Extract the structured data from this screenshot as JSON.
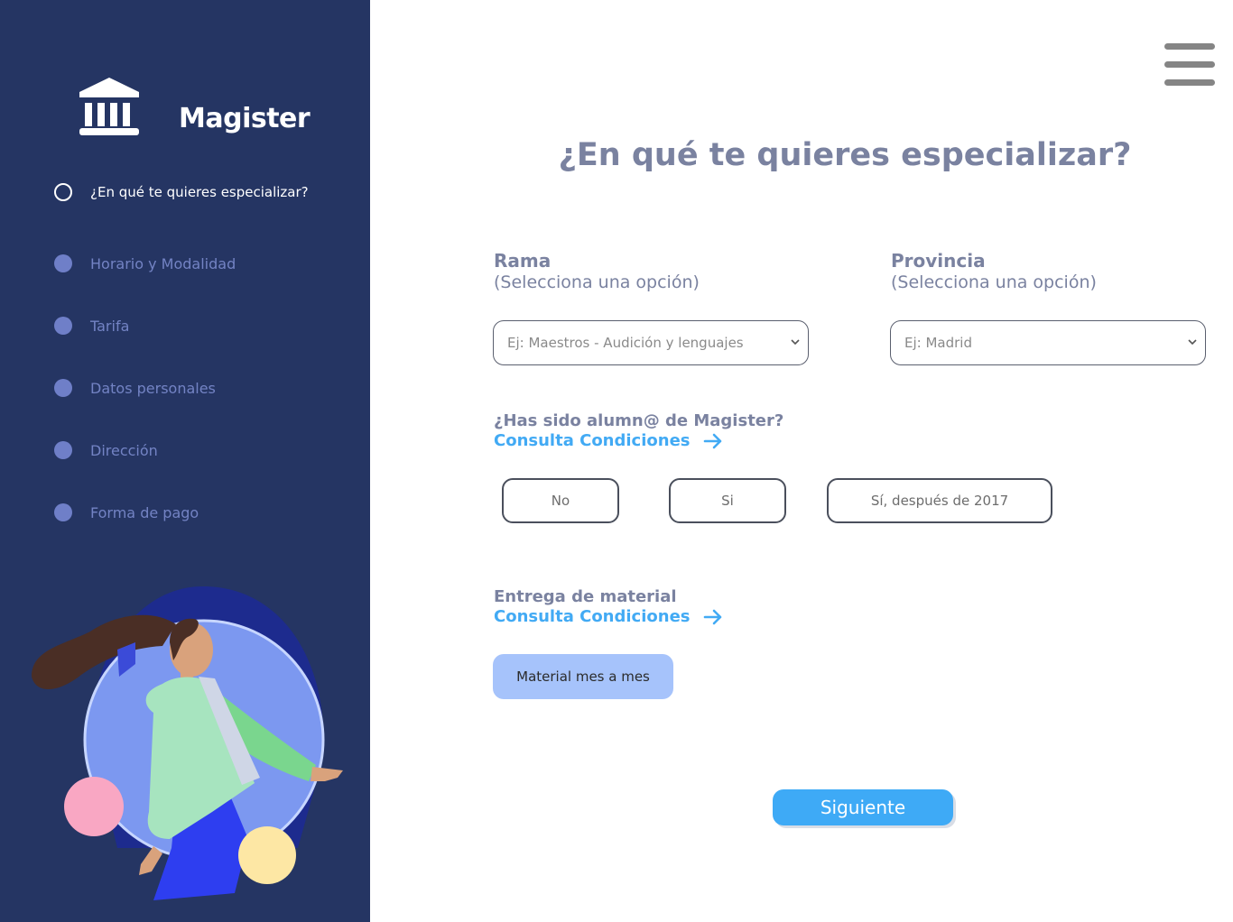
{
  "brand": {
    "name": "Magister"
  },
  "steps": [
    {
      "label": "¿En qué te quieres especializar?",
      "active": true
    },
    {
      "label": "Horario y Modalidad"
    },
    {
      "label": "Tarifa"
    },
    {
      "label": "Datos personales"
    },
    {
      "label": "Dirección"
    },
    {
      "label": "Forma de pago"
    }
  ],
  "page": {
    "title": "¿En qué te quieres especializar?"
  },
  "rama": {
    "label": "Rama",
    "hint": "(Selecciona una opción)",
    "placeholder": "Ej: Maestros - Audición y lenguajes"
  },
  "provincia": {
    "label": "Provincia",
    "hint": "(Selecciona una opción)",
    "placeholder": "Ej: Madrid"
  },
  "alumno": {
    "question": "¿Has sido alumn@ de Magister?",
    "link": "Consulta Condiciones",
    "options": [
      "No",
      "Si",
      "Sí, después de 2017"
    ]
  },
  "material": {
    "question": "Entrega de material",
    "link": "Consulta Condiciones",
    "option": "Material mes a mes"
  },
  "actions": {
    "next": "Siguiente"
  },
  "icons": {
    "logo": "bank-building-icon",
    "menu": "hamburger-menu-icon",
    "arrow": "arrow-right-icon",
    "chevron": "chevron-down-icon"
  },
  "colors": {
    "sidebar": "#253563",
    "accent": "#42aaf4",
    "material_button": "#a6c3fb",
    "step_inactive": "#7383c4"
  }
}
